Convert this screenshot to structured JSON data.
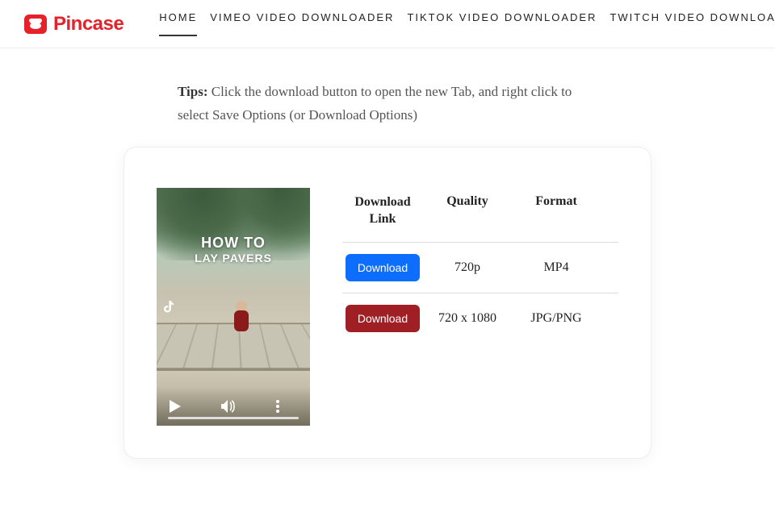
{
  "brand": {
    "name": "Pincase"
  },
  "nav": {
    "items": [
      {
        "label": "HOME",
        "active": true
      },
      {
        "label": "VIMEO VIDEO DOWNLOADER",
        "active": false
      },
      {
        "label": "TIKTOK VIDEO DOWNLOADER",
        "active": false
      },
      {
        "label": "TWITCH VIDEO DOWNLOADER",
        "active": false
      }
    ]
  },
  "tips": {
    "label": "Tips:",
    "text": " Click the download button to open the new Tab, and right click to select Save Options (or Download Options)"
  },
  "preview": {
    "overlay_line1": "HOW TO",
    "overlay_line2": "LAY PAVERS"
  },
  "table": {
    "headers": {
      "link": "Download Link",
      "quality": "Quality",
      "format": "Format"
    },
    "rows": [
      {
        "button": "Download",
        "quality": "720p",
        "format": "MP4",
        "variant": "blue"
      },
      {
        "button": "Download",
        "quality": "720 x 1080",
        "format": "JPG/PNG",
        "variant": "red"
      }
    ]
  }
}
